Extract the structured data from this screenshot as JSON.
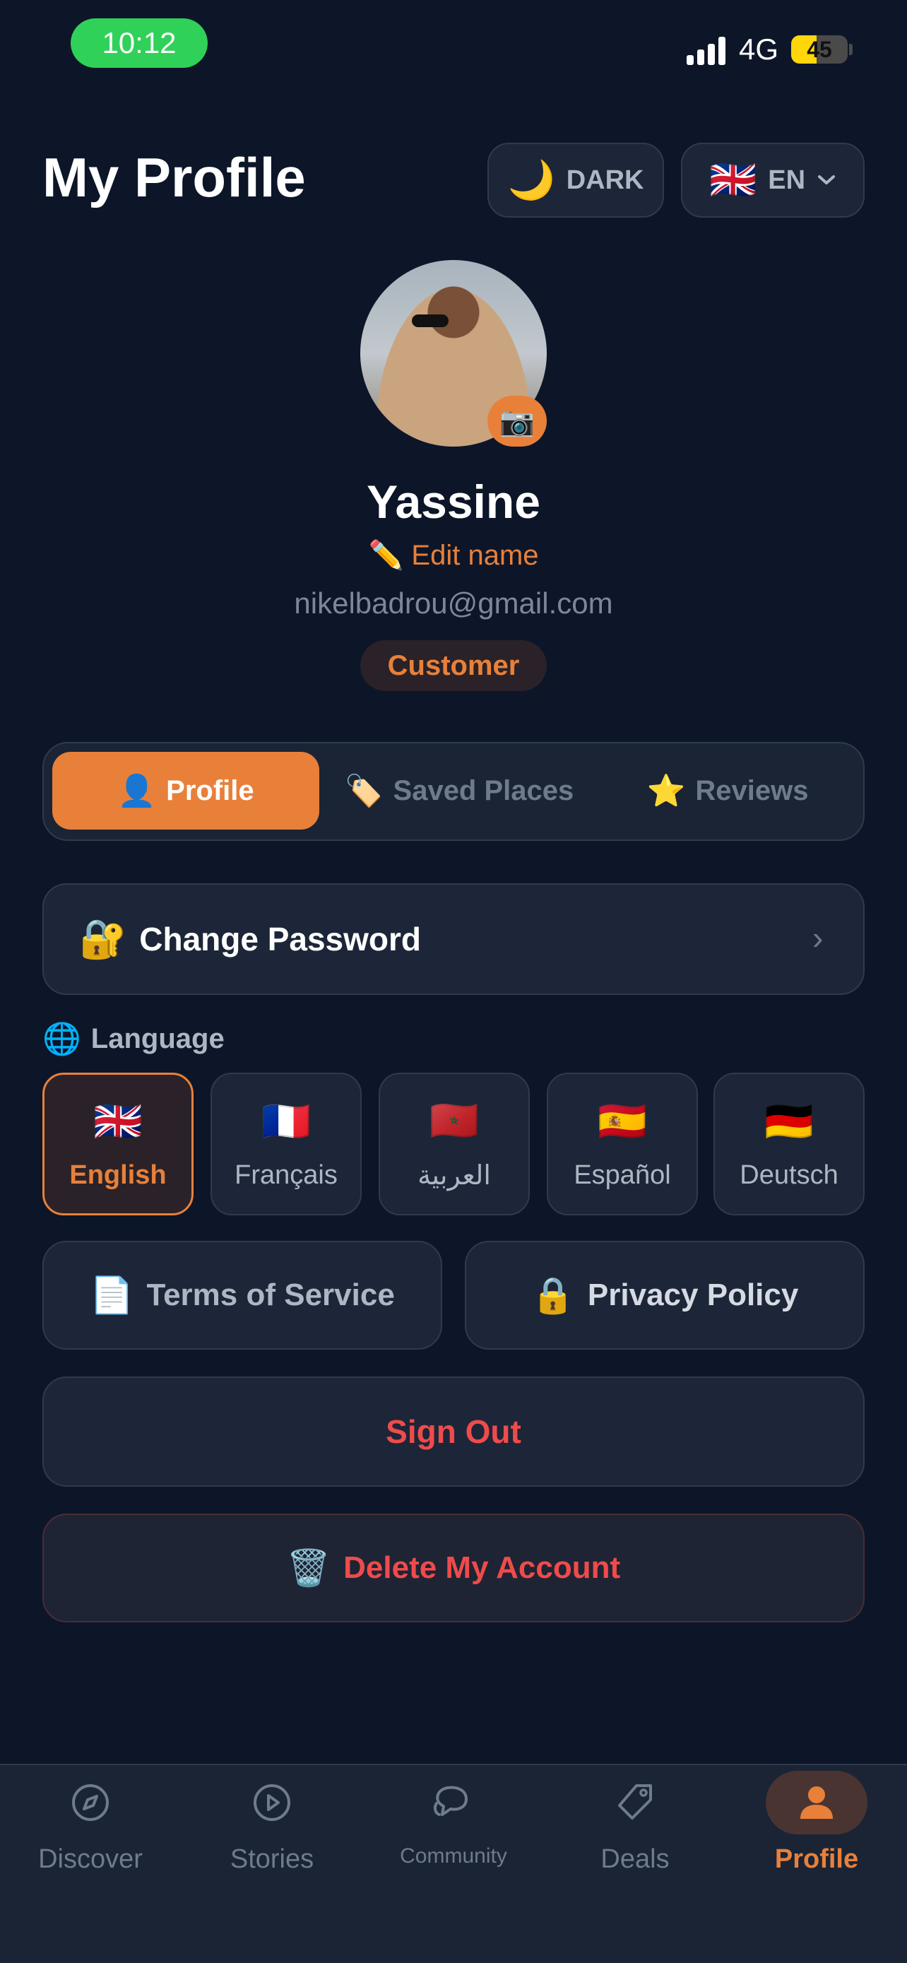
{
  "status_bar": {
    "time": "10:12",
    "network": "4G",
    "battery_percent": 45,
    "battery_label": "45"
  },
  "header": {
    "title": "My Profile",
    "theme_toggle": {
      "icon": "moon-icon",
      "emoji": "🌙",
      "label": "DARK"
    },
    "language_select": {
      "flag": "🇬🇧",
      "label": "EN",
      "icon": "chevron-down-icon"
    }
  },
  "profile": {
    "name": "Yassine",
    "edit_name": {
      "emoji": "✏️",
      "label": "Edit name"
    },
    "email": "nikelbadrou@gmail.com",
    "role": "Customer",
    "camera_emoji": "📷"
  },
  "tabs": [
    {
      "emoji": "👤",
      "label": "Profile",
      "active": true
    },
    {
      "emoji": "🏷️",
      "label": "Saved Places",
      "active": false
    },
    {
      "emoji": "⭐",
      "label": "Reviews",
      "active": false
    }
  ],
  "change_password": {
    "emoji": "🔐",
    "label": "Change Password",
    "chevron": "›"
  },
  "language": {
    "emoji": "🌐",
    "label": "Language",
    "options": [
      {
        "flag": "🇬🇧",
        "label": "English",
        "selected": true
      },
      {
        "flag": "🇫🇷",
        "label": "Français",
        "selected": false
      },
      {
        "flag": "🇲🇦",
        "label": "العربية",
        "selected": false
      },
      {
        "flag": "🇪🇸",
        "label": "Español",
        "selected": false
      },
      {
        "flag": "🇩🇪",
        "label": "Deutsch",
        "selected": false
      }
    ]
  },
  "links": {
    "terms": {
      "emoji": "📄",
      "label": "Terms of Service"
    },
    "privacy": {
      "emoji": "🔒",
      "label": "Privacy Policy"
    }
  },
  "sign_out": {
    "label": "Sign Out"
  },
  "delete_account": {
    "emoji": "🗑️",
    "label": "Delete My Account"
  },
  "bottom_nav": [
    {
      "label": "Discover",
      "icon": "compass-icon",
      "active": false
    },
    {
      "label": "Stories",
      "icon": "play-circle-icon",
      "active": false
    },
    {
      "label": "Community",
      "icon": "chat-bubbles-icon",
      "active": false
    },
    {
      "label": "Deals",
      "icon": "tag-icon",
      "active": false
    },
    {
      "label": "Profile",
      "icon": "person-icon",
      "active": true
    }
  ],
  "colors": {
    "accent": "#e8803a",
    "background": "#0d1628",
    "card": "#1c2638",
    "danger": "#ef4b4b",
    "status_green": "#30d158",
    "battery_yellow": "#ffd60a"
  }
}
